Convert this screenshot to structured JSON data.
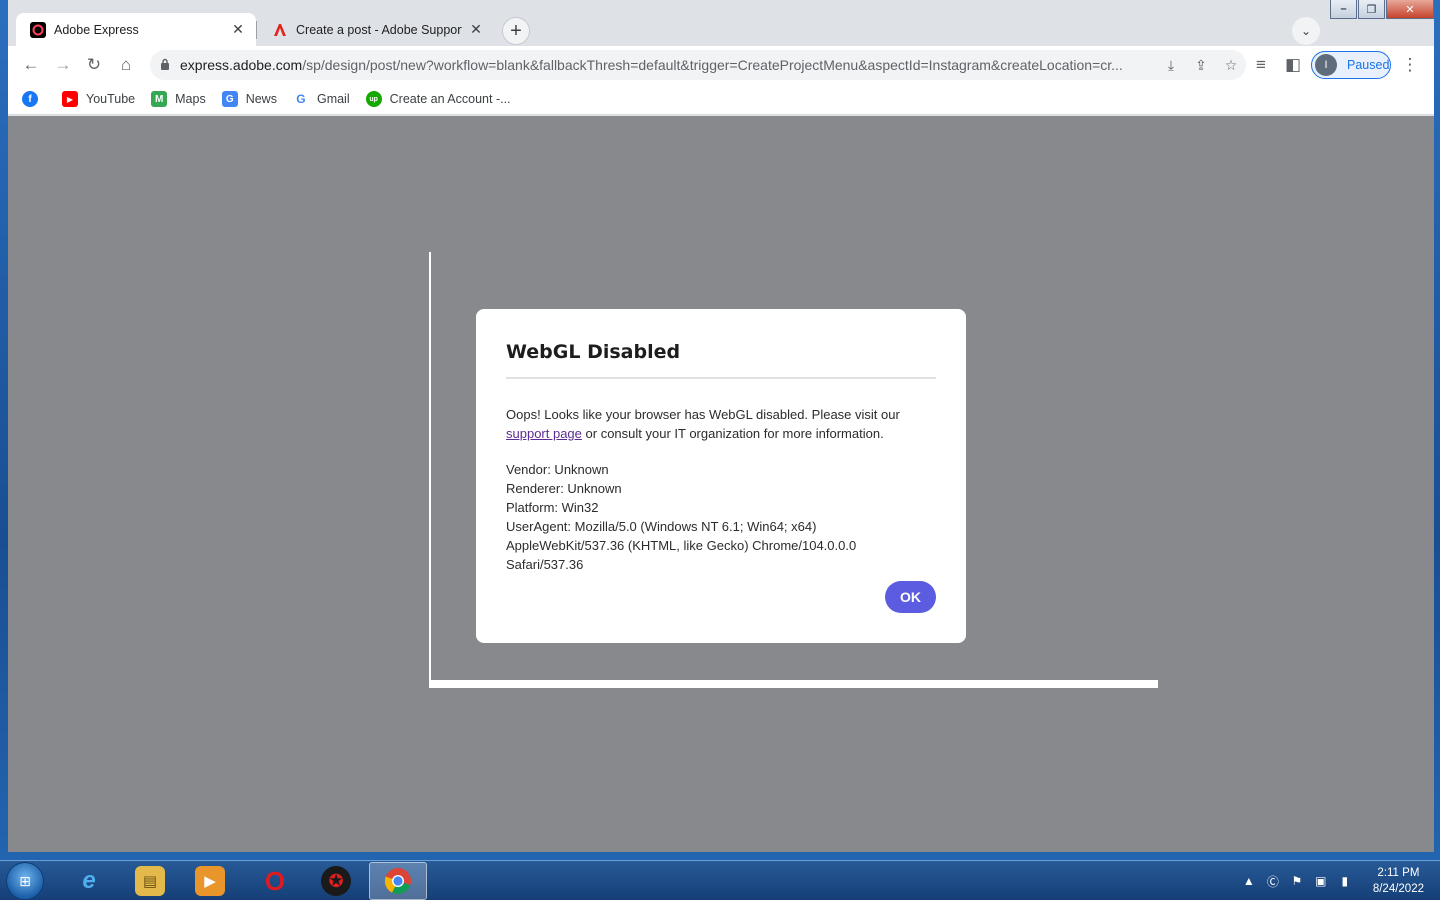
{
  "window": {
    "caption_buttons": [
      "–",
      "❐",
      "✕"
    ]
  },
  "tabs": [
    {
      "title": "Adobe Express",
      "icon": "adobe-express-icon",
      "active": true,
      "close": "✕"
    },
    {
      "title": "Create a post - Adobe Support C",
      "icon": "adobe-acrobat-icon",
      "active": false,
      "close": "✕"
    }
  ],
  "new_tab_label": "+",
  "tab_search_label": "⌄",
  "toolbar": {
    "back": "←",
    "forward": "→",
    "reload": "↻",
    "home": "⌂",
    "lock": "🔒",
    "url_host": "express.adobe.com",
    "url_path": "/sp/design/post/new?workflow=blank&fallbackThresh=default&trigger=CreateProjectMenu&aspectId=Instagram&createLocation=cr...",
    "install_icon": "⤓",
    "share_icon": "⇪",
    "star_icon": "☆",
    "reading_list_icon": "≡",
    "side_panel_icon": "◧",
    "profile_initial": "I",
    "profile_status": "Paused",
    "menu_icon": "⋮"
  },
  "bookmarks": [
    {
      "label": "",
      "icon": "facebook-icon",
      "glyph": "f",
      "color": "#1877f2"
    },
    {
      "label": "YouTube",
      "icon": "youtube-icon",
      "glyph": "▶",
      "color": "#ff0000"
    },
    {
      "label": "Maps",
      "icon": "maps-icon",
      "glyph": "M",
      "color": "#34a853"
    },
    {
      "label": "News",
      "icon": "news-icon",
      "glyph": "G",
      "color": "#4285f4"
    },
    {
      "label": "Gmail",
      "icon": "google-icon",
      "glyph": "G",
      "color": "#ffffff"
    },
    {
      "label": "Create an Account -...",
      "icon": "upwork-icon",
      "glyph": "up",
      "color": "#14a800"
    }
  ],
  "dialog": {
    "title": "WebGL Disabled",
    "body_before_link": "Oops! Looks like your browser has WebGL disabled. Please visit our ",
    "link_text": "support page",
    "body_after_link": " or consult your IT organization for more information.",
    "vendor": "Vendor: Unknown",
    "renderer": "Renderer: Unknown",
    "platform": "Platform: Win32",
    "user_agent": "UserAgent: Mozilla/5.0 (Windows NT 6.1; Win64; x64) AppleWebKit/537.36 (KHTML, like Gecko) Chrome/104.0.0.0 Safari/537.36",
    "ok_label": "OK"
  },
  "taskbar": {
    "start_glyph": "⊞",
    "apps": [
      {
        "name": "internet-explorer-icon",
        "glyph": "e",
        "color": "#1e88d6"
      },
      {
        "name": "file-explorer-icon",
        "glyph": "▤",
        "color": "#e2b94a"
      },
      {
        "name": "media-player-icon",
        "glyph": "▶",
        "color": "#e8962c"
      },
      {
        "name": "opera-icon",
        "glyph": "O",
        "color": "#d61a1f"
      },
      {
        "name": "security-app-icon",
        "glyph": "✪",
        "color": "#b01010"
      },
      {
        "name": "chrome-icon",
        "glyph": "◉",
        "color": "#34a853",
        "active": true
      }
    ],
    "tray_icons": [
      "▲",
      "Ⓒ",
      "⚑",
      "▣",
      "▮"
    ],
    "time": "2:11 PM",
    "date": "8/24/2022"
  }
}
